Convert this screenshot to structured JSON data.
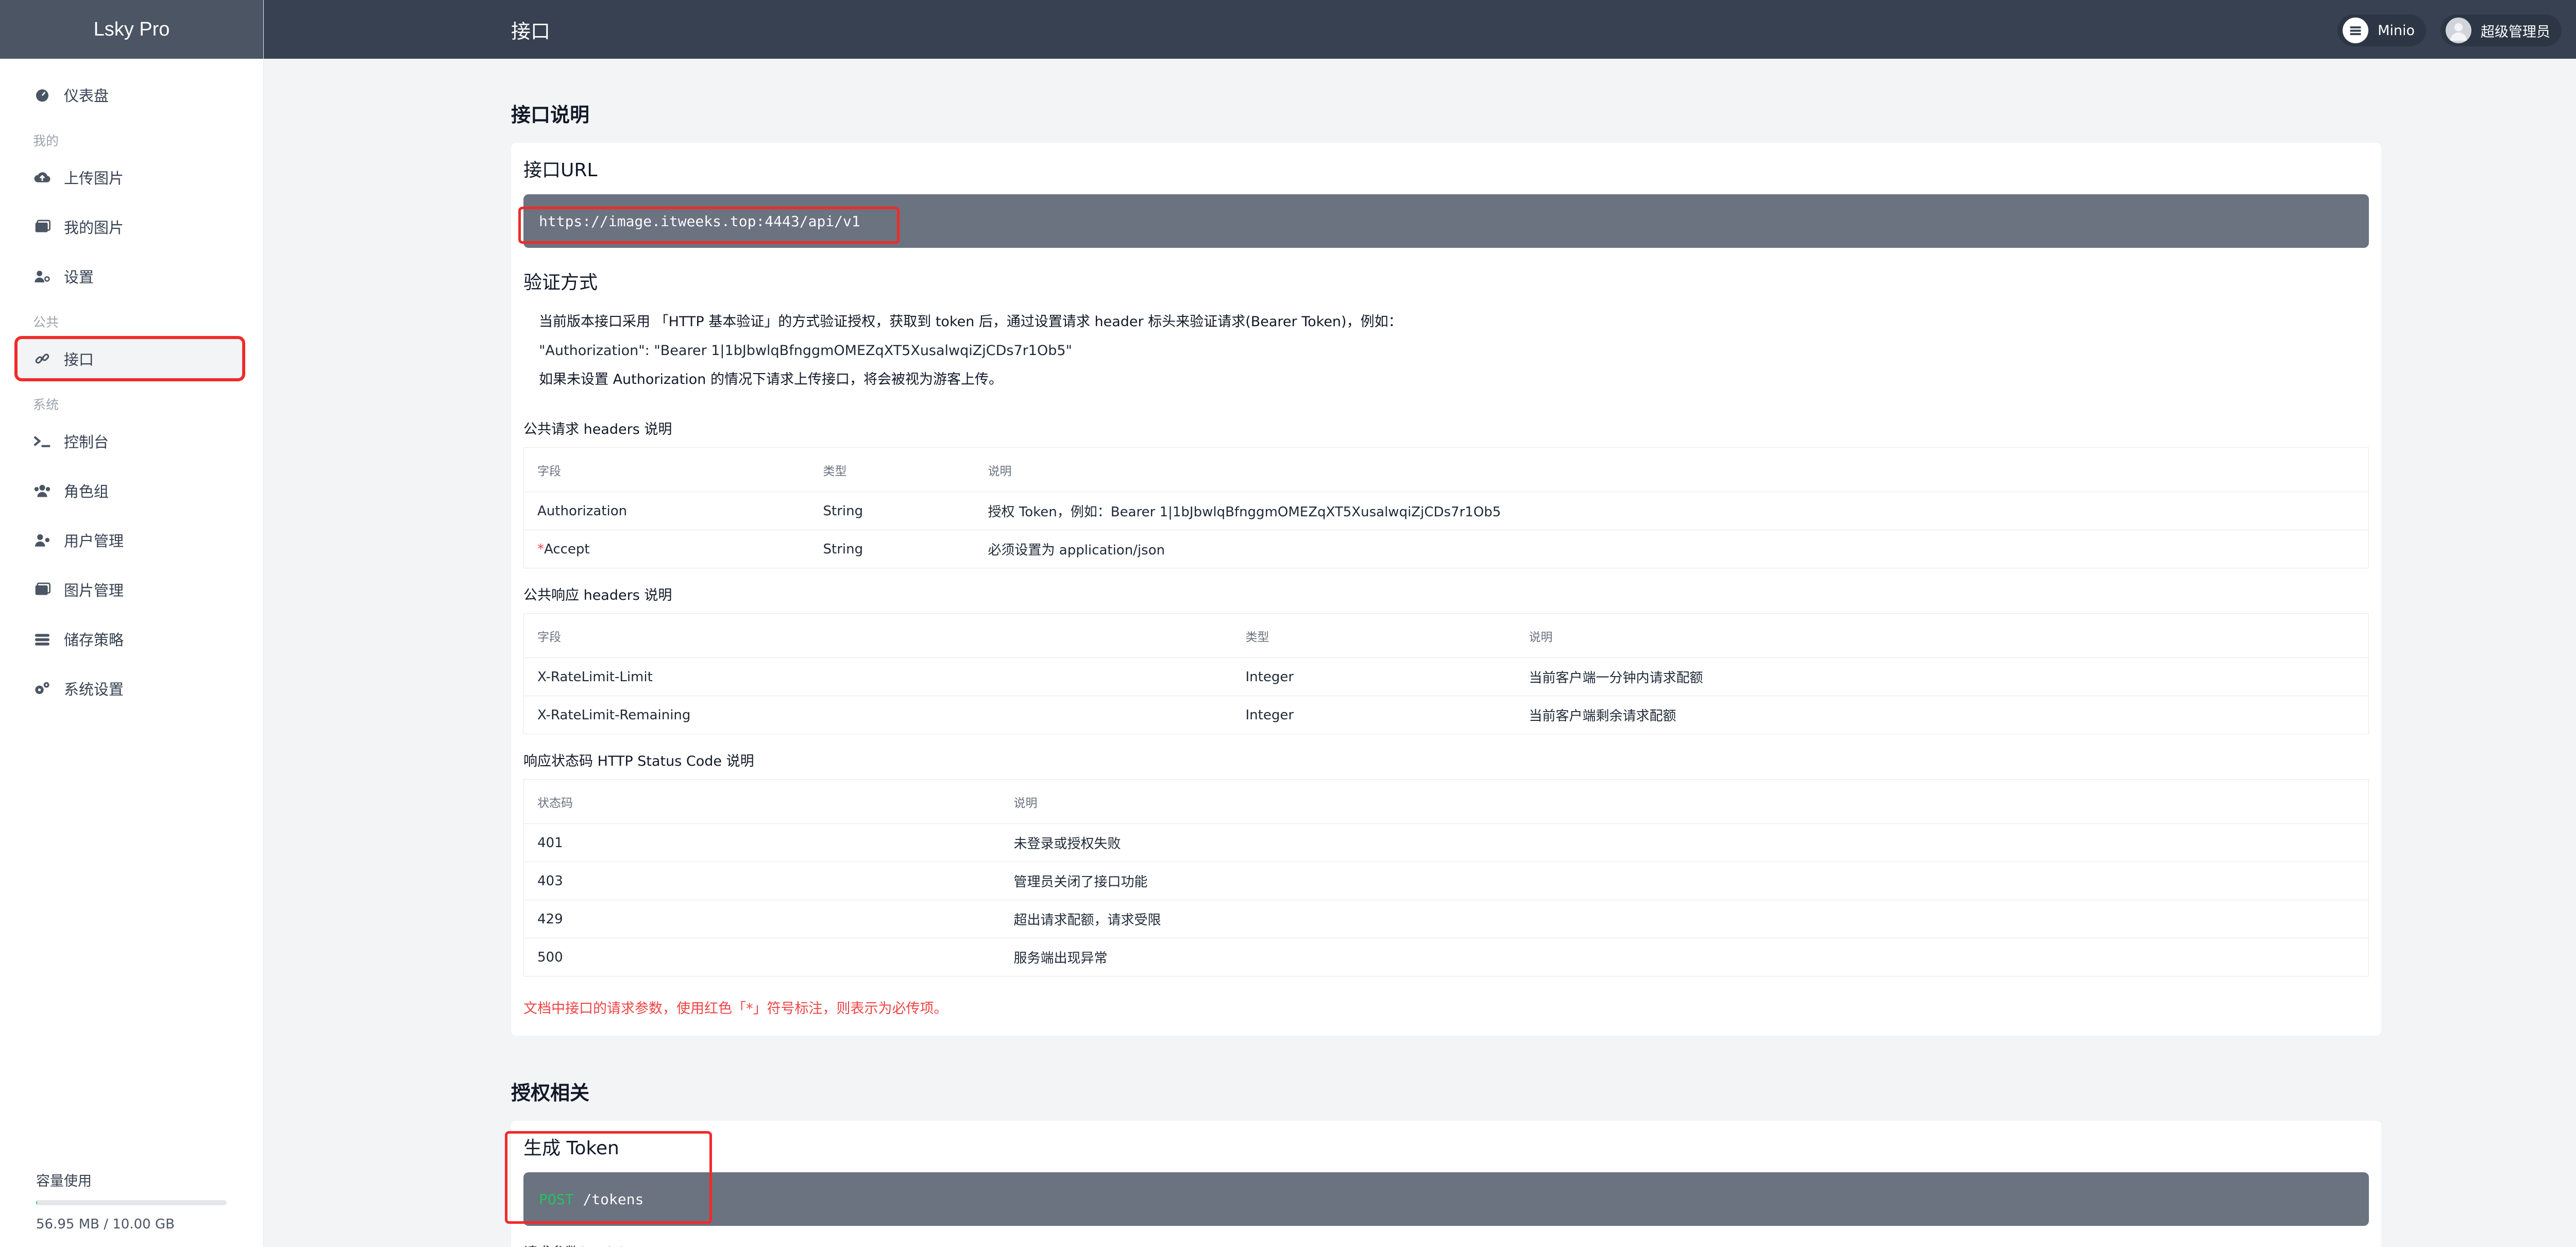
{
  "app": {
    "brand": "Lsky Pro",
    "page_title": "接口"
  },
  "header": {
    "storage_label": "Minio",
    "user_label": "超级管理员"
  },
  "sidebar": {
    "dashboard": "仪表盘",
    "section_mine": "我的",
    "upload": "上传图片",
    "my_images": "我的图片",
    "settings": "设置",
    "section_public": "公共",
    "api": "接口",
    "section_system": "系统",
    "console": "控制台",
    "roles": "角色组",
    "users": "用户管理",
    "images": "图片管理",
    "storage": "储存策略",
    "system_settings": "系统设置"
  },
  "capacity": {
    "label": "容量使用",
    "value": "56.95 MB / 10.00 GB",
    "used_fraction": 0.0056
  },
  "api_doc": {
    "section_title": "接口说明",
    "url_title": "接口URL",
    "url": "https://image.itweeks.top:4443/api/v1",
    "auth_title": "验证方式",
    "auth_line1": "当前版本接口采用 「HTTP 基本验证」的方式验证授权，获取到 token 后，通过设置请求 header 标头来验证请求(Bearer Token)，例如：",
    "auth_line2": "\"Authorization\": \"Bearer 1|1bJbwlqBfnggmOMEZqXT5XusalwqiZjCDs7r1Ob5\"",
    "auth_line3": "如果未设置 Authorization 的情况下请求上传接口，将会被视为游客上传。",
    "req_headers_label": "公共请求 headers 说明",
    "req_headers_cols": [
      "字段",
      "类型",
      "说明"
    ],
    "req_headers_rows": [
      [
        "Authorization",
        "String",
        "授权 Token，例如：Bearer 1|1bJbwlqBfnggmOMEZqXT5XusalwqiZjCDs7r1Ob5"
      ],
      [
        "Accept",
        "String",
        "必须设置为 application/json"
      ]
    ],
    "required_mark": "*",
    "resp_headers_label": "公共响应 headers 说明",
    "resp_headers_cols": [
      "字段",
      "类型",
      "说明"
    ],
    "resp_headers_rows": [
      [
        "X-RateLimit-Limit",
        "Integer",
        "当前客户端一分钟内请求配额"
      ],
      [
        "X-RateLimit-Remaining",
        "Integer",
        "当前客户端剩余请求配额"
      ]
    ],
    "status_label": "响应状态码 HTTP Status Code 说明",
    "status_cols": [
      "状态码",
      "说明"
    ],
    "status_rows": [
      [
        "401",
        "未登录或授权失败"
      ],
      [
        "403",
        "管理员关闭了接口功能"
      ],
      [
        "429",
        "超出请求配额，请求受限"
      ],
      [
        "500",
        "服务端出现异常"
      ]
    ],
    "note": "文档中接口的请求参数，使用红色「*」符号标注，则表示为必传项。"
  },
  "auth_section": {
    "title": "授权相关",
    "token_title": "生成 Token",
    "method": "POST",
    "path": "/tokens",
    "body_label": "请求参数(Body)"
  }
}
